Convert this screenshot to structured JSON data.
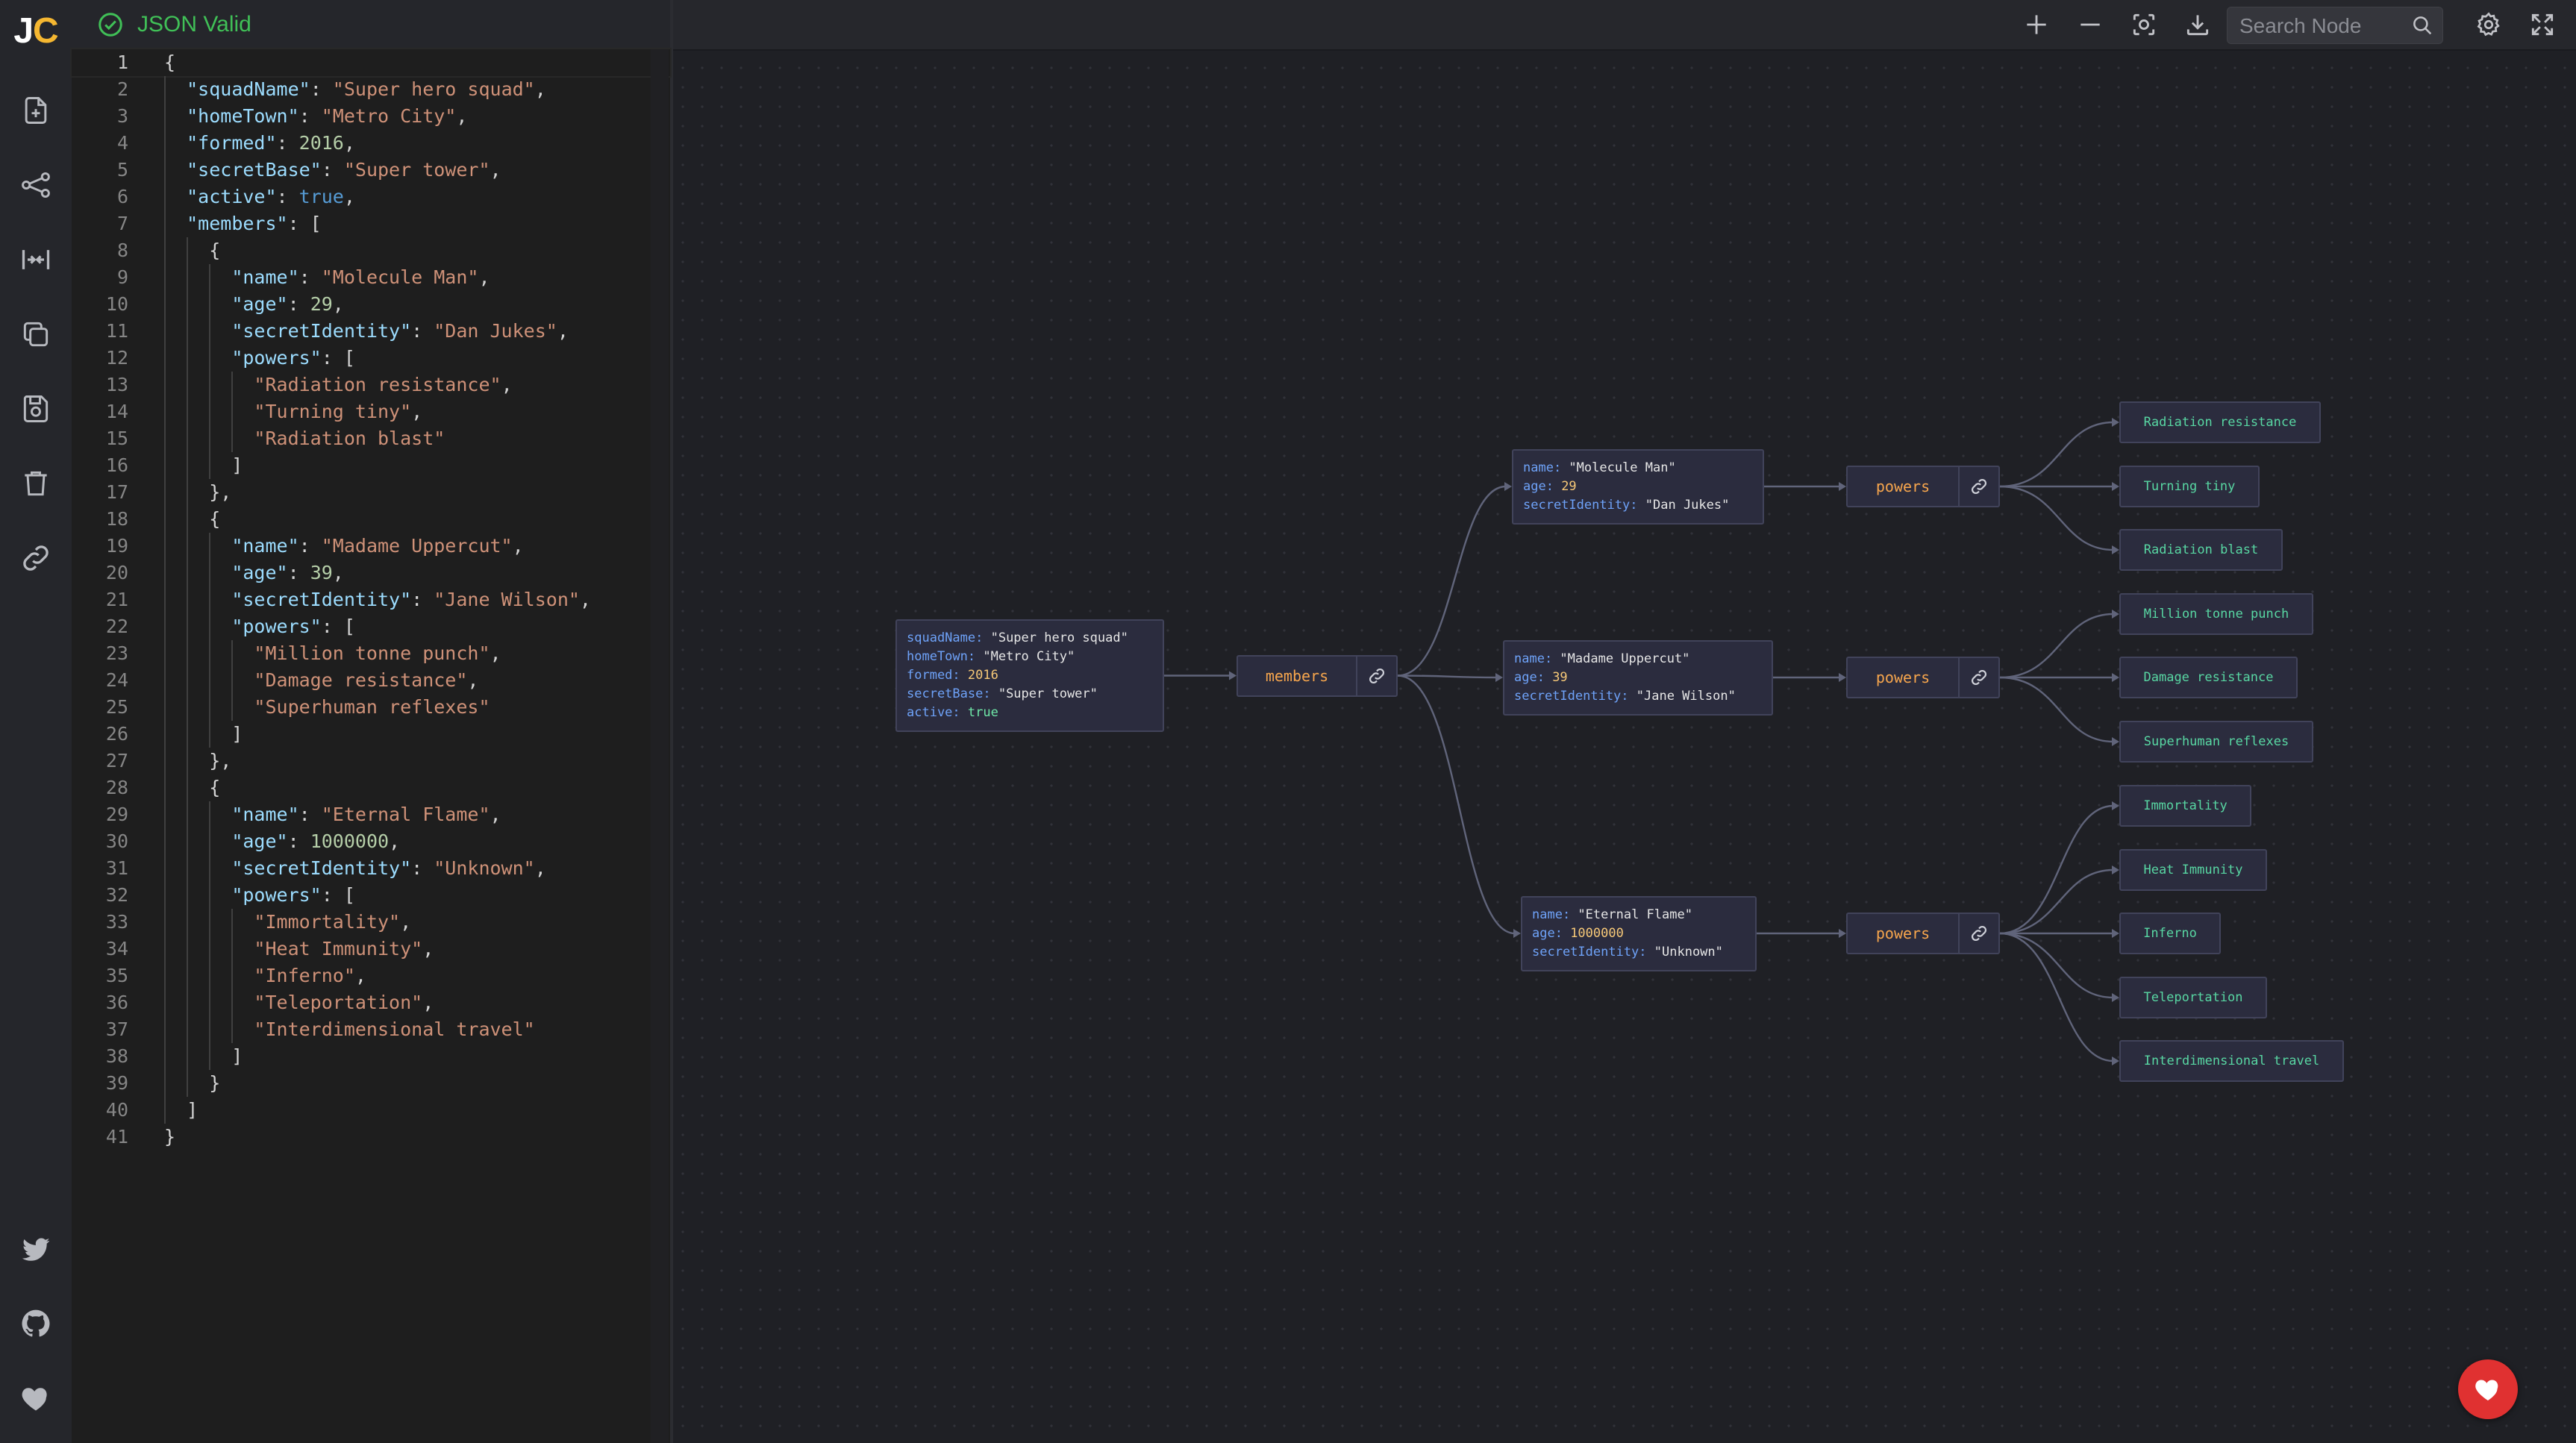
{
  "app": {
    "logo_j": "J",
    "logo_c": "C",
    "status_text": "JSON Valid"
  },
  "sidebar": {
    "icons": [
      "new-file-icon",
      "graph-share-icon",
      "collapse-icon",
      "copy-icon",
      "save-icon",
      "trash-icon",
      "link-icon"
    ],
    "bottom_icons": [
      "twitter-icon",
      "github-icon",
      "heart-icon"
    ]
  },
  "toolbar": {
    "search_placeholder": "Search Node",
    "icons": [
      "zoom-in-icon",
      "zoom-out-icon",
      "center-view-icon",
      "download-icon",
      "search-icon",
      "settings-icon",
      "fullscreen-icon"
    ]
  },
  "editor": {
    "active_line": 1,
    "lines": [
      [
        [
          "p",
          "{"
        ]
      ],
      [
        [
          "p",
          "  "
        ],
        [
          "k",
          "\"squadName\""
        ],
        [
          "p",
          ": "
        ],
        [
          "s",
          "\"Super hero squad\""
        ],
        [
          "p",
          ","
        ]
      ],
      [
        [
          "p",
          "  "
        ],
        [
          "k",
          "\"homeTown\""
        ],
        [
          "p",
          ": "
        ],
        [
          "s",
          "\"Metro City\""
        ],
        [
          "p",
          ","
        ]
      ],
      [
        [
          "p",
          "  "
        ],
        [
          "k",
          "\"formed\""
        ],
        [
          "p",
          ": "
        ],
        [
          "n",
          "2016"
        ],
        [
          "p",
          ","
        ]
      ],
      [
        [
          "p",
          "  "
        ],
        [
          "k",
          "\"secretBase\""
        ],
        [
          "p",
          ": "
        ],
        [
          "s",
          "\"Super tower\""
        ],
        [
          "p",
          ","
        ]
      ],
      [
        [
          "p",
          "  "
        ],
        [
          "k",
          "\"active\""
        ],
        [
          "p",
          ": "
        ],
        [
          "b",
          "true"
        ],
        [
          "p",
          ","
        ]
      ],
      [
        [
          "p",
          "  "
        ],
        [
          "k",
          "\"members\""
        ],
        [
          "p",
          ": ["
        ]
      ],
      [
        [
          "p",
          "    {"
        ]
      ],
      [
        [
          "p",
          "      "
        ],
        [
          "k",
          "\"name\""
        ],
        [
          "p",
          ": "
        ],
        [
          "s",
          "\"Molecule Man\""
        ],
        [
          "p",
          ","
        ]
      ],
      [
        [
          "p",
          "      "
        ],
        [
          "k",
          "\"age\""
        ],
        [
          "p",
          ": "
        ],
        [
          "n",
          "29"
        ],
        [
          "p",
          ","
        ]
      ],
      [
        [
          "p",
          "      "
        ],
        [
          "k",
          "\"secretIdentity\""
        ],
        [
          "p",
          ": "
        ],
        [
          "s",
          "\"Dan Jukes\""
        ],
        [
          "p",
          ","
        ]
      ],
      [
        [
          "p",
          "      "
        ],
        [
          "k",
          "\"powers\""
        ],
        [
          "p",
          ": ["
        ]
      ],
      [
        [
          "p",
          "        "
        ],
        [
          "s",
          "\"Radiation resistance\""
        ],
        [
          "p",
          ","
        ]
      ],
      [
        [
          "p",
          "        "
        ],
        [
          "s",
          "\"Turning tiny\""
        ],
        [
          "p",
          ","
        ]
      ],
      [
        [
          "p",
          "        "
        ],
        [
          "s",
          "\"Radiation blast\""
        ]
      ],
      [
        [
          "p",
          "      ]"
        ]
      ],
      [
        [
          "p",
          "    },"
        ]
      ],
      [
        [
          "p",
          "    {"
        ]
      ],
      [
        [
          "p",
          "      "
        ],
        [
          "k",
          "\"name\""
        ],
        [
          "p",
          ": "
        ],
        [
          "s",
          "\"Madame Uppercut\""
        ],
        [
          "p",
          ","
        ]
      ],
      [
        [
          "p",
          "      "
        ],
        [
          "k",
          "\"age\""
        ],
        [
          "p",
          ": "
        ],
        [
          "n",
          "39"
        ],
        [
          "p",
          ","
        ]
      ],
      [
        [
          "p",
          "      "
        ],
        [
          "k",
          "\"secretIdentity\""
        ],
        [
          "p",
          ": "
        ],
        [
          "s",
          "\"Jane Wilson\""
        ],
        [
          "p",
          ","
        ]
      ],
      [
        [
          "p",
          "      "
        ],
        [
          "k",
          "\"powers\""
        ],
        [
          "p",
          ": ["
        ]
      ],
      [
        [
          "p",
          "        "
        ],
        [
          "s",
          "\"Million tonne punch\""
        ],
        [
          "p",
          ","
        ]
      ],
      [
        [
          "p",
          "        "
        ],
        [
          "s",
          "\"Damage resistance\""
        ],
        [
          "p",
          ","
        ]
      ],
      [
        [
          "p",
          "        "
        ],
        [
          "s",
          "\"Superhuman reflexes\""
        ]
      ],
      [
        [
          "p",
          "      ]"
        ]
      ],
      [
        [
          "p",
          "    },"
        ]
      ],
      [
        [
          "p",
          "    {"
        ]
      ],
      [
        [
          "p",
          "      "
        ],
        [
          "k",
          "\"name\""
        ],
        [
          "p",
          ": "
        ],
        [
          "s",
          "\"Eternal Flame\""
        ],
        [
          "p",
          ","
        ]
      ],
      [
        [
          "p",
          "      "
        ],
        [
          "k",
          "\"age\""
        ],
        [
          "p",
          ": "
        ],
        [
          "n",
          "1000000"
        ],
        [
          "p",
          ","
        ]
      ],
      [
        [
          "p",
          "      "
        ],
        [
          "k",
          "\"secretIdentity\""
        ],
        [
          "p",
          ": "
        ],
        [
          "s",
          "\"Unknown\""
        ],
        [
          "p",
          ","
        ]
      ],
      [
        [
          "p",
          "      "
        ],
        [
          "k",
          "\"powers\""
        ],
        [
          "p",
          ": ["
        ]
      ],
      [
        [
          "p",
          "        "
        ],
        [
          "s",
          "\"Immortality\""
        ],
        [
          "p",
          ","
        ]
      ],
      [
        [
          "p",
          "        "
        ],
        [
          "s",
          "\"Heat Immunity\""
        ],
        [
          "p",
          ","
        ]
      ],
      [
        [
          "p",
          "        "
        ],
        [
          "s",
          "\"Inferno\""
        ],
        [
          "p",
          ","
        ]
      ],
      [
        [
          "p",
          "        "
        ],
        [
          "s",
          "\"Teleportation\""
        ],
        [
          "p",
          ","
        ]
      ],
      [
        [
          "p",
          "        "
        ],
        [
          "s",
          "\"Interdimensional travel\""
        ]
      ],
      [
        [
          "p",
          "      ]"
        ]
      ],
      [
        [
          "p",
          "    }"
        ]
      ],
      [
        [
          "p",
          "  ]"
        ]
      ],
      [
        [
          "p",
          "}"
        ]
      ]
    ]
  },
  "graph": {
    "root": {
      "rows": [
        {
          "key": "squadName:",
          "value": "\"Super hero squad\"",
          "type": "string"
        },
        {
          "key": "homeTown:",
          "value": "\"Metro City\"",
          "type": "string"
        },
        {
          "key": "formed:",
          "value": "2016",
          "type": "number"
        },
        {
          "key": "secretBase:",
          "value": "\"Super tower\"",
          "type": "string"
        },
        {
          "key": "active:",
          "value": "true",
          "type": "bool"
        }
      ]
    },
    "members_label": "members",
    "members": [
      {
        "rows": [
          {
            "key": "name:",
            "value": "\"Molecule Man\"",
            "type": "string"
          },
          {
            "key": "age:",
            "value": "29",
            "type": "number"
          },
          {
            "key": "secretIdentity:",
            "value": "\"Dan Jukes\"",
            "type": "string"
          }
        ],
        "powers_label": "powers",
        "powers": [
          "Radiation resistance",
          "Turning tiny",
          "Radiation blast"
        ]
      },
      {
        "rows": [
          {
            "key": "name:",
            "value": "\"Madame Uppercut\"",
            "type": "string"
          },
          {
            "key": "age:",
            "value": "39",
            "type": "number"
          },
          {
            "key": "secretIdentity:",
            "value": "\"Jane Wilson\"",
            "type": "string"
          }
        ],
        "powers_label": "powers",
        "powers": [
          "Million tonne punch",
          "Damage resistance",
          "Superhuman reflexes"
        ]
      },
      {
        "rows": [
          {
            "key": "name:",
            "value": "\"Eternal Flame\"",
            "type": "string"
          },
          {
            "key": "age:",
            "value": "1000000",
            "type": "number"
          },
          {
            "key": "secretIdentity:",
            "value": "\"Unknown\"",
            "type": "string"
          }
        ],
        "powers_label": "powers",
        "powers": [
          "Immortality",
          "Heat Immunity",
          "Inferno",
          "Teleportation",
          "Interdimensional travel"
        ]
      }
    ]
  },
  "colors": {
    "valid": "#40c057",
    "logo_accent": "#f5b731",
    "key": "#6ea2f8",
    "leaf_text": "#58d7a3",
    "parent_label": "#f7a64d",
    "number": "#f7c978",
    "fab": "#e03131"
  }
}
